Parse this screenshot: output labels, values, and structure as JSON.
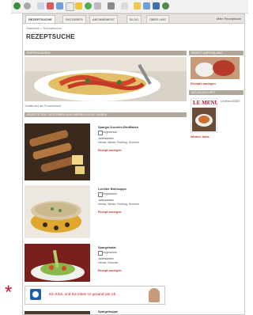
{
  "nav": {
    "tabs": [
      "Rezeptsuche",
      "Ratgeber",
      "Abonnement",
      "Blog",
      "Über uns"
    ],
    "right": "Mein Rezeptbuch"
  },
  "breadcrumb": "Startseite > Rezeptsuche",
  "page_title": "REZEPTSUCHE",
  "hero": {
    "bar_label": "Empfehlungen",
    "caption": "Tomate aus der Provenzhand"
  },
  "results": {
    "bar_label": "Rezepte der \"Vegetarischen Spargelküche\" finden",
    "items": [
      {
        "name": "Spargel-Zucchini-Brotfladen",
        "tag": "Vegetarisch",
        "label": "Jahreszeiten",
        "seasons": "Herbst, Winter, Frühling, Sommer",
        "link": "Rezept anzeigen"
      },
      {
        "name": "Leichter Brühsuppe",
        "tag": "Vegetarisch",
        "label": "Jahreszeiten",
        "seasons": "Herbst, Winter, Frühling, Sommer",
        "link": "Rezept anzeigen"
      },
      {
        "name": "Spargelsalat",
        "tag": "Vegetarisch",
        "label": "Jahreszeiten",
        "seasons": "Herbst, Sommer",
        "link": "Rezept anzeigen"
      },
      {
        "name": "Spargelsuppe"
      }
    ]
  },
  "sidebar": {
    "box1": {
      "bar_label": "Rezept-Empfehlung",
      "link": "Rezepte anzeigen"
    },
    "box2": {
      "bar_label": "Aktuelles Heft",
      "magazine_title": "LE MENU",
      "text": "Le Menu 04/2007",
      "link": "Weitere Infos"
    }
  },
  "banner": {
    "text": "Ein Klick, und Sie leben so gesund wie ich."
  },
  "annotation": "*",
  "colors": {
    "bar": "#b0a99b",
    "link": "#c23a2a",
    "banner_red": "#c8102e"
  }
}
